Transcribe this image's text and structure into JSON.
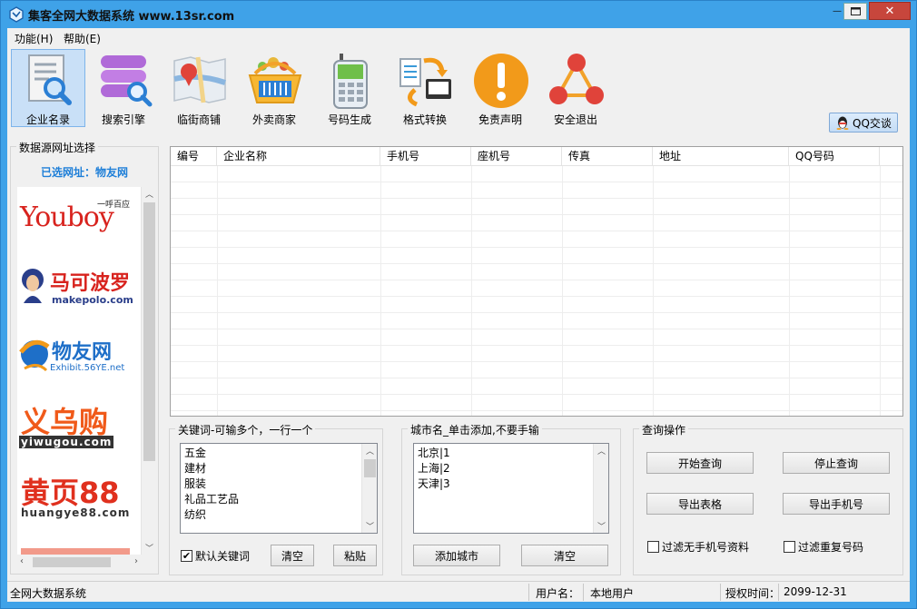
{
  "window": {
    "title": "集客全网大数据系统   www.13sr.com",
    "minimize_symbol": "—",
    "close_symbol": "✕"
  },
  "menu": [
    {
      "label": "功能(H)"
    },
    {
      "label": "帮助(E)"
    }
  ],
  "toolbar": [
    {
      "label": "企业名录",
      "icon": "document-search-icon",
      "active": true
    },
    {
      "label": "搜索引擎",
      "icon": "database-search-icon",
      "active": false
    },
    {
      "label": "临街商铺",
      "icon": "map-pin-icon",
      "active": false
    },
    {
      "label": "外卖商家",
      "icon": "shopping-basket-icon",
      "active": false
    },
    {
      "label": "号码生成",
      "icon": "phone-icon",
      "active": false
    },
    {
      "label": "格式转换",
      "icon": "convert-icon",
      "active": false
    },
    {
      "label": "免责声明",
      "icon": "warning-icon",
      "active": false
    },
    {
      "label": "安全退出",
      "icon": "exit-network-icon",
      "active": false
    }
  ],
  "qq_button": {
    "label": "QQ交谈",
    "icon": "qq-penguin-icon"
  },
  "source_panel": {
    "title": "数据源网址选择",
    "selected": "已选网址：物友网",
    "logos": [
      {
        "name": "Youboy",
        "tagline": "一呼百应"
      },
      {
        "name": "马可波罗",
        "subtitle": "makepolo.com"
      },
      {
        "name": "物友网",
        "subtitle": "Exhibit.56YE.net"
      },
      {
        "name": "义乌购",
        "subtitle": "yiwugou.com"
      },
      {
        "name": "黄页88",
        "subtitle": "huangye88.com"
      }
    ]
  },
  "grid": {
    "columns": [
      "编号",
      "企业名称",
      "手机号",
      "座机号",
      "传真",
      "地址",
      "QQ号码"
    ],
    "rows": []
  },
  "keywords": {
    "title": "关键词-可输多个，一行一个",
    "items": [
      "五金",
      "建材",
      "服装",
      "礼品工艺品",
      "纺织"
    ],
    "default_checkbox": {
      "label": "默认关键词",
      "checked": true
    },
    "clear_label": "清空",
    "paste_label": "粘贴"
  },
  "cities": {
    "title": "城市名_单击添加,不要手输",
    "items": [
      "北京|1",
      "上海|2",
      "天津|3"
    ],
    "add_label": "添加城市",
    "clear_label": "清空"
  },
  "query": {
    "title": "查询操作",
    "start_label": "开始查询",
    "stop_label": "停止查询",
    "export_table_label": "导出表格",
    "export_phone_label": "导出手机号",
    "filter_no_phone": {
      "label": "过滤无手机号资料",
      "checked": false
    },
    "filter_dup": {
      "label": "过滤重复号码",
      "checked": false
    }
  },
  "status": {
    "app_name": "全网大数据系统",
    "user_label": "用户名：",
    "user_value": "本地用户",
    "auth_label": "授权时间：",
    "auth_value": "2099-12-31"
  },
  "colors": {
    "title_bar": "#3fa2e8",
    "selected_site": "#1e7fd8",
    "close_button": "#c7463c"
  }
}
